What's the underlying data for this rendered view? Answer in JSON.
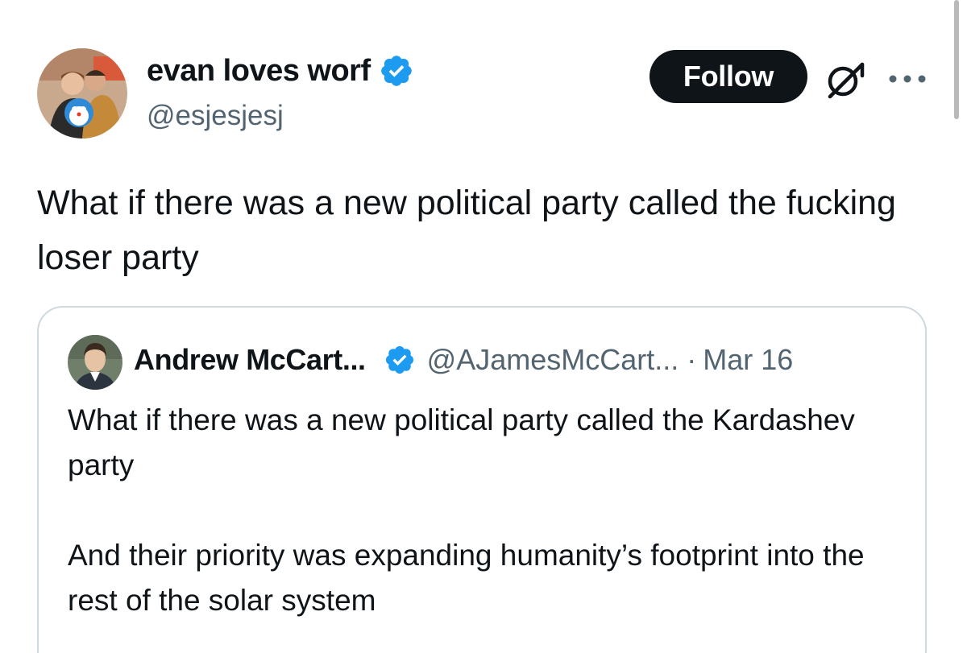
{
  "tweet": {
    "author": {
      "display_name": "evan loves worf",
      "handle": "@esjesjesj",
      "verified": true,
      "avatar": "profile-photo-avatar"
    },
    "follow_label": "Follow",
    "icons": {
      "grok": "grok-icon",
      "more": "more-options-icon"
    },
    "text": "What if there was a new political party called the fucking loser party"
  },
  "quoted_tweet": {
    "author": {
      "display_name": "Andrew McCart...",
      "handle": "@AJamesMcCart...",
      "verified": true,
      "avatar": "profile-photo-avatar"
    },
    "separator": "·",
    "date": "Mar 16",
    "paragraphs": [
      "What if there was a new political party called the Kardashev party",
      "And their priority was expanding humanity’s footprint into the rest of the solar system"
    ]
  },
  "colors": {
    "text_primary": "#0f1419",
    "text_secondary": "#536471",
    "verified_blue": "#1d9bf0",
    "button_bg": "#0f1419",
    "border": "#cfd9de"
  }
}
